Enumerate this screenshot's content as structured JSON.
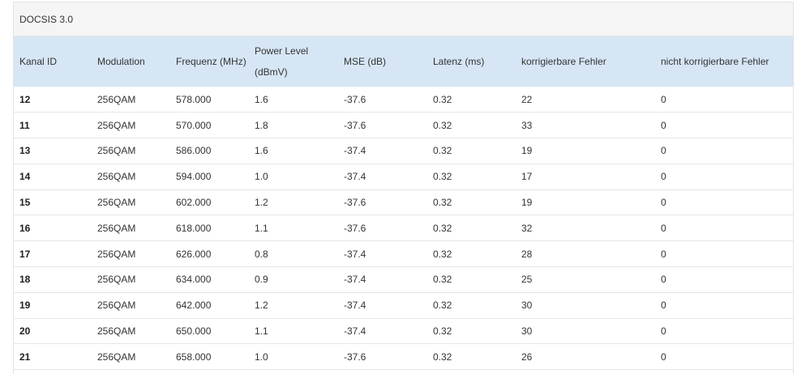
{
  "panel": {
    "title": "DOCSIS 3.0"
  },
  "table": {
    "headers": {
      "kanal_id": "Kanal ID",
      "modulation": "Modulation",
      "frequenz": "Frequenz (MHz)",
      "power_level_line1": "Power Level",
      "power_level_line2": "(dBmV)",
      "mse": "MSE (dB)",
      "latenz": "Latenz (ms)",
      "korrigierbare": "korrigierbare Fehler",
      "nicht_korrigierbare": "nicht korrigierbare Fehler"
    },
    "rows": [
      {
        "id": "12",
        "mod": "256QAM",
        "freq": "578.000",
        "power": "1.6",
        "mse": "-37.6",
        "lat": "0.32",
        "korr": "22",
        "nkorr": "0"
      },
      {
        "id": "11",
        "mod": "256QAM",
        "freq": "570.000",
        "power": "1.8",
        "mse": "-37.6",
        "lat": "0.32",
        "korr": "33",
        "nkorr": "0"
      },
      {
        "id": "13",
        "mod": "256QAM",
        "freq": "586.000",
        "power": "1.6",
        "mse": "-37.4",
        "lat": "0.32",
        "korr": "19",
        "nkorr": "0"
      },
      {
        "id": "14",
        "mod": "256QAM",
        "freq": "594.000",
        "power": "1.0",
        "mse": "-37.4",
        "lat": "0.32",
        "korr": "17",
        "nkorr": "0"
      },
      {
        "id": "15",
        "mod": "256QAM",
        "freq": "602.000",
        "power": "1.2",
        "mse": "-37.6",
        "lat": "0.32",
        "korr": "19",
        "nkorr": "0"
      },
      {
        "id": "16",
        "mod": "256QAM",
        "freq": "618.000",
        "power": "1.1",
        "mse": "-37.6",
        "lat": "0.32",
        "korr": "32",
        "nkorr": "0"
      },
      {
        "id": "17",
        "mod": "256QAM",
        "freq": "626.000",
        "power": "0.8",
        "mse": "-37.4",
        "lat": "0.32",
        "korr": "28",
        "nkorr": "0"
      },
      {
        "id": "18",
        "mod": "256QAM",
        "freq": "634.000",
        "power": "0.9",
        "mse": "-37.4",
        "lat": "0.32",
        "korr": "25",
        "nkorr": "0"
      },
      {
        "id": "19",
        "mod": "256QAM",
        "freq": "642.000",
        "power": "1.2",
        "mse": "-37.4",
        "lat": "0.32",
        "korr": "30",
        "nkorr": "0"
      },
      {
        "id": "20",
        "mod": "256QAM",
        "freq": "650.000",
        "power": "1.1",
        "mse": "-37.4",
        "lat": "0.32",
        "korr": "30",
        "nkorr": "0"
      },
      {
        "id": "21",
        "mod": "256QAM",
        "freq": "658.000",
        "power": "1.0",
        "mse": "-37.6",
        "lat": "0.32",
        "korr": "26",
        "nkorr": "0"
      }
    ]
  },
  "colors": {
    "header_bg": "#d6e6f5",
    "title_bg": "#f5f5f5",
    "row_border": "#e6e6e6"
  }
}
